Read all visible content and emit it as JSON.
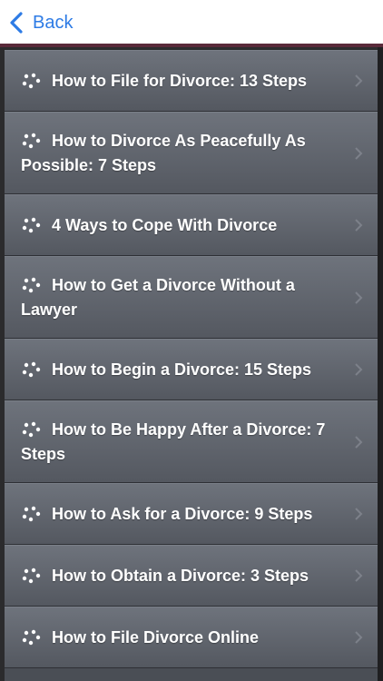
{
  "nav": {
    "back_label": "Back"
  },
  "items": [
    {
      "label": "How to File for Divorce: 13 Steps"
    },
    {
      "label": "How to Divorce As Peacefully As Possible: 7 Steps"
    },
    {
      "label": "4 Ways to Cope With Divorce"
    },
    {
      "label": "How to Get a Divorce Without a Lawyer"
    },
    {
      "label": "How to Begin a Divorce: 15 Steps"
    },
    {
      "label": "How to Be Happy After a Divorce: 7 Steps"
    },
    {
      "label": "How to Ask for a Divorce: 9 Steps"
    },
    {
      "label": "How to Obtain a Divorce: 3 Steps"
    },
    {
      "label": "How to File Divorce Online"
    }
  ],
  "colors": {
    "accent": "#2d7be5",
    "divider": "#5a2a3a"
  },
  "icons": {
    "bullet": "dots-cluster-icon",
    "row_arrow": "chevron-right-icon",
    "back": "chevron-left-icon"
  }
}
